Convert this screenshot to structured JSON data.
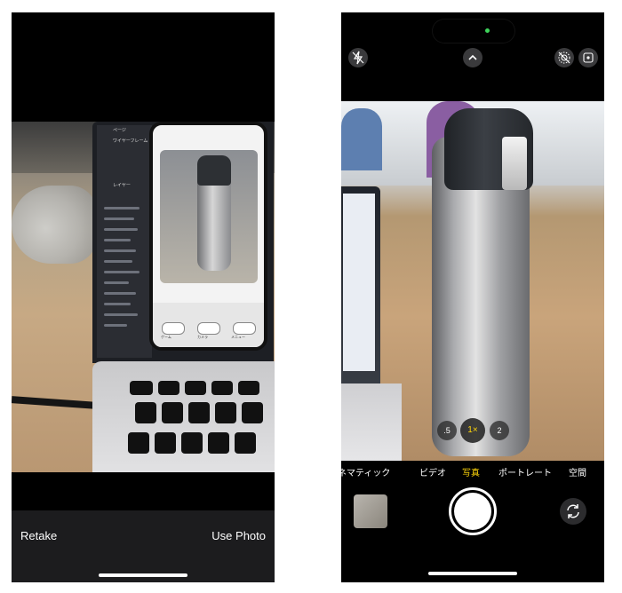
{
  "review_screen": {
    "retake_label": "Retake",
    "use_photo_label": "Use Photo"
  },
  "camera_screen": {
    "zoom_options": [
      ".5",
      "1×",
      "2"
    ],
    "selected_zoom": "1×",
    "modes": [
      "シネマティック",
      "ビデオ",
      "写真",
      "ポートレート",
      "空間"
    ],
    "selected_mode": "写真",
    "accent_color": "#ffd60a"
  },
  "laptop_screen_text": {
    "pages_header": "ページ",
    "wireframe_label": "ワイヤーフレーム",
    "layers_header": "レイヤー"
  },
  "mock_phone_buttons": [
    "ゲーム",
    "カメラ",
    "メニュー"
  ]
}
